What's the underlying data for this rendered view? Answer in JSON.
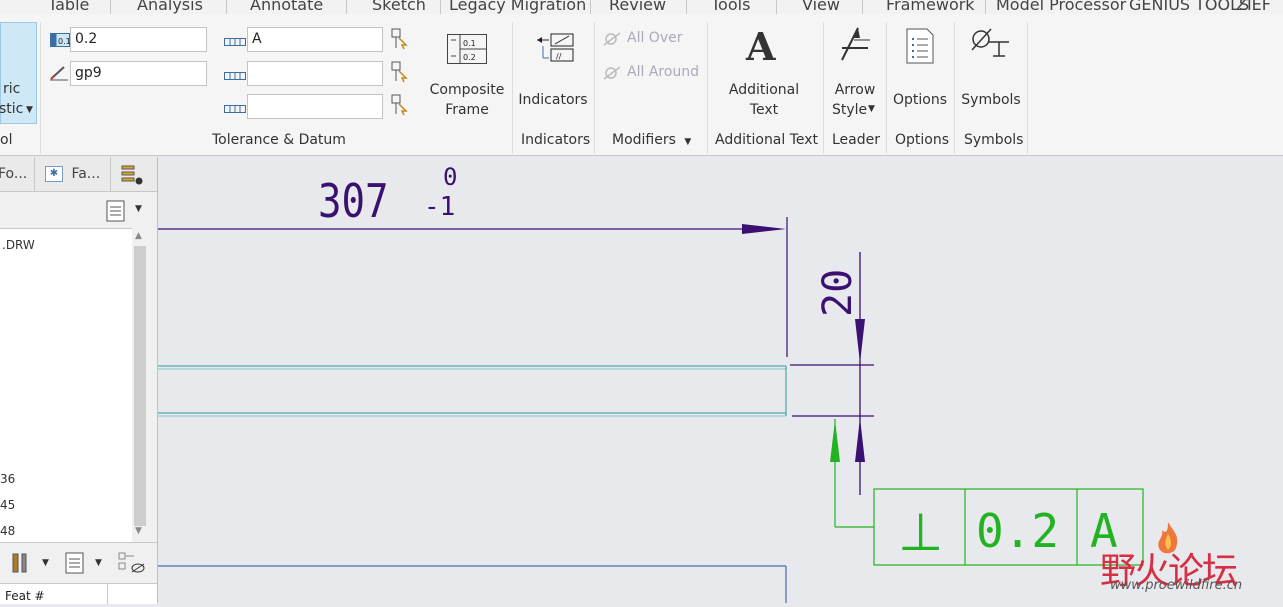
{
  "menu": {
    "tabs": [
      "Table",
      "Analysis",
      "Annotate",
      "Sketch",
      "Legacy Migration",
      "Review",
      "Tools",
      "View",
      "Framework",
      "Model Processor",
      "GENIUS TOOLS",
      "ZIEF"
    ]
  },
  "ribbon": {
    "partial_button": {
      "line1": "ric",
      "line2": "stic",
      "group": "ol"
    },
    "tolerance_datum": {
      "tolerance_value": "0.2",
      "geometric_id": "gp9",
      "datum_primary": "A",
      "datum_secondary": "",
      "datum_tertiary": "",
      "composite_frame_label": "Composite Frame",
      "composite_frame_line1": "Composite",
      "composite_frame_line2": "Frame",
      "group_label": "Tolerance & Datum"
    },
    "indicators": {
      "button_label": "Indicators",
      "group_label": "Indicators"
    },
    "modifiers": {
      "all_over": "All Over",
      "all_around": "All Around",
      "group_label": "Modifiers"
    },
    "additional_text": {
      "line1": "Additional",
      "line2": "Text",
      "group_label": "Additional Text"
    },
    "leader": {
      "line1": "Arrow",
      "line2": "Style",
      "group_label": "Leader"
    },
    "options": {
      "button_label": "Options",
      "group_label": "Options"
    },
    "symbols": {
      "button_label": "Symbols",
      "group_label": "Symbols"
    },
    "frame_cells": [
      "0.1",
      "0.2"
    ]
  },
  "left_panel": {
    "tab1": "Fo...",
    "tab2": "Fa...",
    "tree_top": ".DRW",
    "tree_numbers": [
      "36",
      "45",
      "48"
    ],
    "feat_header": "Feat #"
  },
  "drawing": {
    "dim_top_value": "307",
    "dim_top_upper_tol": "0",
    "dim_top_lower_tol": "-1",
    "dim_vertical_value": "20",
    "gtol_symbol": "⊥",
    "gtol_value": "0.2",
    "gtol_datum": "A"
  },
  "watermark": {
    "text": "野火论坛",
    "url": "www.proewildfire.cn"
  },
  "colors": {
    "dim_purple": "#3a1070",
    "gtol_green": "#22b322",
    "edge_teal": "#2b9a9a",
    "edge_blue": "#1f4f9f"
  }
}
